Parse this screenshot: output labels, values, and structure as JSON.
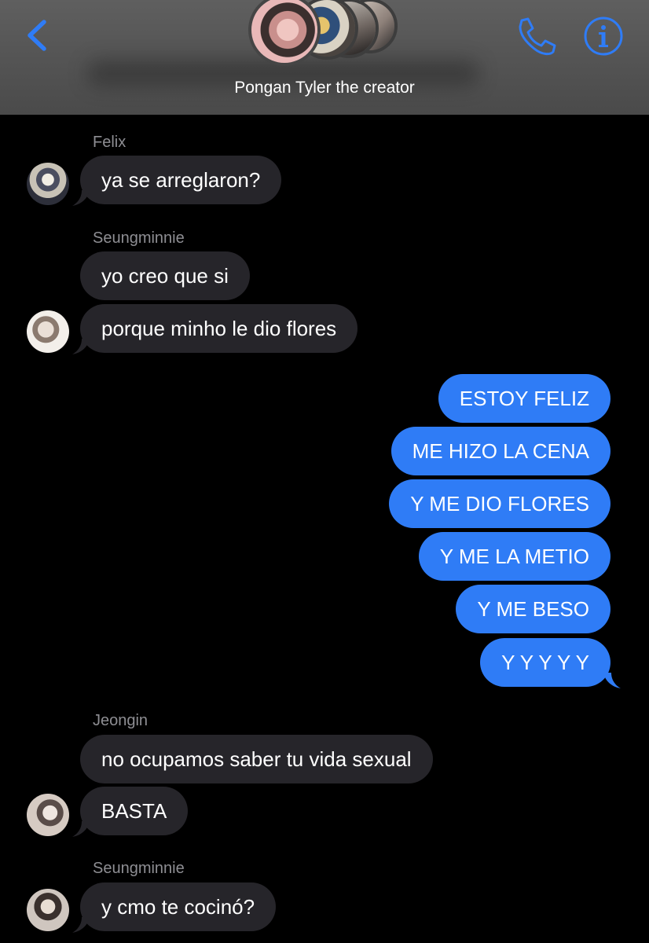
{
  "header": {
    "title": "Pongan Tyler the creator",
    "back_icon": "chevron-left-icon",
    "call_icon": "phone-icon",
    "info_icon": "info-icon",
    "accent": "#2f7cf6"
  },
  "colors": {
    "incoming_bubble": "#26252a",
    "outgoing_bubble": "#2f7cf6",
    "sender_name": "#8e8e93",
    "background": "#000000"
  },
  "messages": {
    "felix_name": "Felix",
    "m1": "ya se arreglaron?",
    "seung1_name": "Seungminnie",
    "m2": "yo creo que si",
    "m3": "porque minho le dio flores",
    "o1": "ESTOY FELIZ",
    "o2": "ME HIZO LA CENA",
    "o3": "Y ME DIO FLORES",
    "o4": "Y ME LA METIO",
    "o5": "Y ME BESO",
    "o6": "Y Y Y Y Y",
    "jeongin_name": "Jeongin",
    "m4": "no ocupamos saber tu vida sexual",
    "m5": "BASTA",
    "seung2_name": "Seungminnie",
    "m6": "y cmo te cocinó?"
  }
}
